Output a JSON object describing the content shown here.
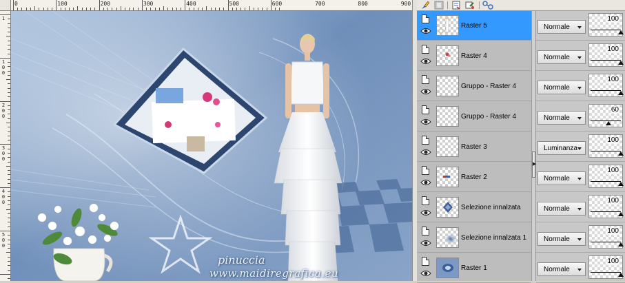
{
  "canvas": {
    "ruler_top_numbers": [
      "0",
      "100",
      "200",
      "300",
      "400",
      "500",
      "600",
      "700",
      "800",
      "900"
    ],
    "ruler_left_numbers": [
      "1",
      "100",
      "200",
      "300",
      "400",
      "500",
      "600"
    ],
    "signature_name": "pinuccia",
    "signature_site": "www.maidiregrafica.eu"
  },
  "toolbar": {
    "icons": [
      "brush-icon",
      "mask-icon",
      "new-layer-icon",
      "properties-icon",
      "link-icon"
    ]
  },
  "layers": [
    {
      "name": "Raster 5",
      "blend": "Normale",
      "opacity": "100",
      "opacity_level": 100,
      "selected": true,
      "thumb": "figure"
    },
    {
      "name": "Raster 4",
      "blend": "Normale",
      "opacity": "100",
      "opacity_level": 100,
      "selected": false,
      "thumb": "flowers"
    },
    {
      "name": "Gruppo - Raster 4",
      "blend": "Normale",
      "opacity": "100",
      "opacity_level": 100,
      "selected": false,
      "thumb": "empty"
    },
    {
      "name": "Gruppo - Raster 4",
      "blend": "Normale",
      "opacity": "60",
      "opacity_level": 60,
      "selected": false,
      "thumb": "empty"
    },
    {
      "name": "Raster 3",
      "blend": "Luminanza",
      "opacity": "100",
      "opacity_level": 100,
      "selected": false,
      "thumb": "empty"
    },
    {
      "name": "Raster 2",
      "blend": "Normale",
      "opacity": "100",
      "opacity_level": 100,
      "selected": false,
      "thumb": "star"
    },
    {
      "name": "Selezione innalzata",
      "blend": "Normale",
      "opacity": "100",
      "opacity_level": 100,
      "selected": false,
      "thumb": "diamond"
    },
    {
      "name": "Selezione innalzata 1",
      "blend": "Normale",
      "opacity": "100",
      "opacity_level": 100,
      "selected": false,
      "thumb": "blur"
    },
    {
      "name": "Raster 1",
      "blend": "Normale",
      "opacity": "100",
      "opacity_level": 100,
      "selected": false,
      "thumb": "blue"
    }
  ],
  "colors": {
    "selected_layer": "#3399ff",
    "canvas_blue": "#6f8fba",
    "panel_gray": "#bdbdbd"
  }
}
